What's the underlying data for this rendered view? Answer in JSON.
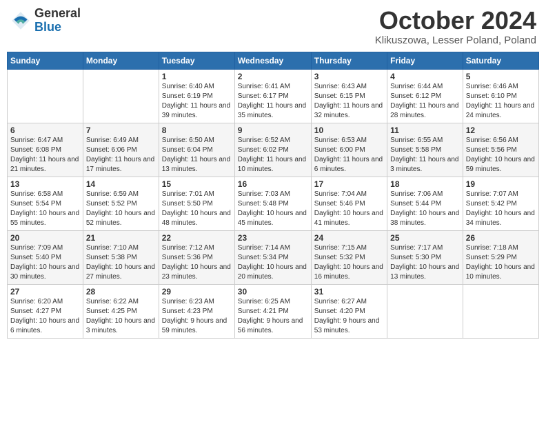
{
  "header": {
    "logo_general": "General",
    "logo_blue": "Blue",
    "title": "October 2024",
    "location": "Klikuszowa, Lesser Poland, Poland"
  },
  "days_of_week": [
    "Sunday",
    "Monday",
    "Tuesday",
    "Wednesday",
    "Thursday",
    "Friday",
    "Saturday"
  ],
  "weeks": [
    [
      {
        "day": null,
        "info": null
      },
      {
        "day": null,
        "info": null
      },
      {
        "day": "1",
        "info": "Sunrise: 6:40 AM\nSunset: 6:19 PM\nDaylight: 11 hours and 39 minutes."
      },
      {
        "day": "2",
        "info": "Sunrise: 6:41 AM\nSunset: 6:17 PM\nDaylight: 11 hours and 35 minutes."
      },
      {
        "day": "3",
        "info": "Sunrise: 6:43 AM\nSunset: 6:15 PM\nDaylight: 11 hours and 32 minutes."
      },
      {
        "day": "4",
        "info": "Sunrise: 6:44 AM\nSunset: 6:12 PM\nDaylight: 11 hours and 28 minutes."
      },
      {
        "day": "5",
        "info": "Sunrise: 6:46 AM\nSunset: 6:10 PM\nDaylight: 11 hours and 24 minutes."
      }
    ],
    [
      {
        "day": "6",
        "info": "Sunrise: 6:47 AM\nSunset: 6:08 PM\nDaylight: 11 hours and 21 minutes."
      },
      {
        "day": "7",
        "info": "Sunrise: 6:49 AM\nSunset: 6:06 PM\nDaylight: 11 hours and 17 minutes."
      },
      {
        "day": "8",
        "info": "Sunrise: 6:50 AM\nSunset: 6:04 PM\nDaylight: 11 hours and 13 minutes."
      },
      {
        "day": "9",
        "info": "Sunrise: 6:52 AM\nSunset: 6:02 PM\nDaylight: 11 hours and 10 minutes."
      },
      {
        "day": "10",
        "info": "Sunrise: 6:53 AM\nSunset: 6:00 PM\nDaylight: 11 hours and 6 minutes."
      },
      {
        "day": "11",
        "info": "Sunrise: 6:55 AM\nSunset: 5:58 PM\nDaylight: 11 hours and 3 minutes."
      },
      {
        "day": "12",
        "info": "Sunrise: 6:56 AM\nSunset: 5:56 PM\nDaylight: 10 hours and 59 minutes."
      }
    ],
    [
      {
        "day": "13",
        "info": "Sunrise: 6:58 AM\nSunset: 5:54 PM\nDaylight: 10 hours and 55 minutes."
      },
      {
        "day": "14",
        "info": "Sunrise: 6:59 AM\nSunset: 5:52 PM\nDaylight: 10 hours and 52 minutes."
      },
      {
        "day": "15",
        "info": "Sunrise: 7:01 AM\nSunset: 5:50 PM\nDaylight: 10 hours and 48 minutes."
      },
      {
        "day": "16",
        "info": "Sunrise: 7:03 AM\nSunset: 5:48 PM\nDaylight: 10 hours and 45 minutes."
      },
      {
        "day": "17",
        "info": "Sunrise: 7:04 AM\nSunset: 5:46 PM\nDaylight: 10 hours and 41 minutes."
      },
      {
        "day": "18",
        "info": "Sunrise: 7:06 AM\nSunset: 5:44 PM\nDaylight: 10 hours and 38 minutes."
      },
      {
        "day": "19",
        "info": "Sunrise: 7:07 AM\nSunset: 5:42 PM\nDaylight: 10 hours and 34 minutes."
      }
    ],
    [
      {
        "day": "20",
        "info": "Sunrise: 7:09 AM\nSunset: 5:40 PM\nDaylight: 10 hours and 30 minutes."
      },
      {
        "day": "21",
        "info": "Sunrise: 7:10 AM\nSunset: 5:38 PM\nDaylight: 10 hours and 27 minutes."
      },
      {
        "day": "22",
        "info": "Sunrise: 7:12 AM\nSunset: 5:36 PM\nDaylight: 10 hours and 23 minutes."
      },
      {
        "day": "23",
        "info": "Sunrise: 7:14 AM\nSunset: 5:34 PM\nDaylight: 10 hours and 20 minutes."
      },
      {
        "day": "24",
        "info": "Sunrise: 7:15 AM\nSunset: 5:32 PM\nDaylight: 10 hours and 16 minutes."
      },
      {
        "day": "25",
        "info": "Sunrise: 7:17 AM\nSunset: 5:30 PM\nDaylight: 10 hours and 13 minutes."
      },
      {
        "day": "26",
        "info": "Sunrise: 7:18 AM\nSunset: 5:29 PM\nDaylight: 10 hours and 10 minutes."
      }
    ],
    [
      {
        "day": "27",
        "info": "Sunrise: 6:20 AM\nSunset: 4:27 PM\nDaylight: 10 hours and 6 minutes."
      },
      {
        "day": "28",
        "info": "Sunrise: 6:22 AM\nSunset: 4:25 PM\nDaylight: 10 hours and 3 minutes."
      },
      {
        "day": "29",
        "info": "Sunrise: 6:23 AM\nSunset: 4:23 PM\nDaylight: 9 hours and 59 minutes."
      },
      {
        "day": "30",
        "info": "Sunrise: 6:25 AM\nSunset: 4:21 PM\nDaylight: 9 hours and 56 minutes."
      },
      {
        "day": "31",
        "info": "Sunrise: 6:27 AM\nSunset: 4:20 PM\nDaylight: 9 hours and 53 minutes."
      },
      {
        "day": null,
        "info": null
      },
      {
        "day": null,
        "info": null
      }
    ]
  ]
}
